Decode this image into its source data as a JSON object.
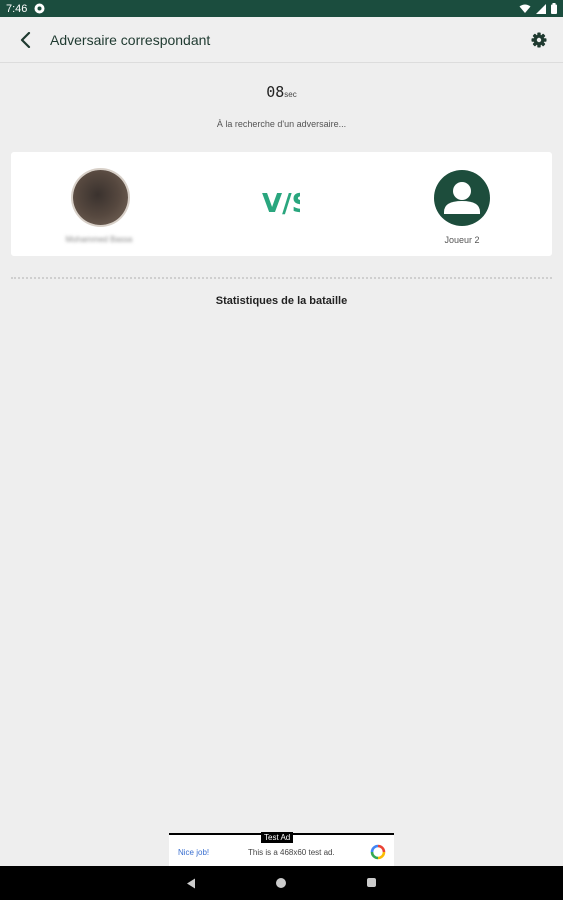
{
  "status_bar": {
    "time": "7:46"
  },
  "app_bar": {
    "title": "Adversaire correspondant"
  },
  "timer": {
    "value": "08",
    "unit": "sec"
  },
  "searching_text": "À la recherche d'un adversaire...",
  "match": {
    "player1": {
      "name": "Mohammed Bassa"
    },
    "vs_label": "V/S",
    "player2": {
      "name": "Joueur 2"
    }
  },
  "stats": {
    "title": "Statistiques de la bataille"
  },
  "ad": {
    "tag": "Test Ad",
    "left_text": "Nice job!",
    "middle_text": "This is a 468x60 test ad."
  },
  "colors": {
    "primary": "#1b4d3e",
    "accent": "#2aa67e",
    "background": "#eeeeee"
  }
}
